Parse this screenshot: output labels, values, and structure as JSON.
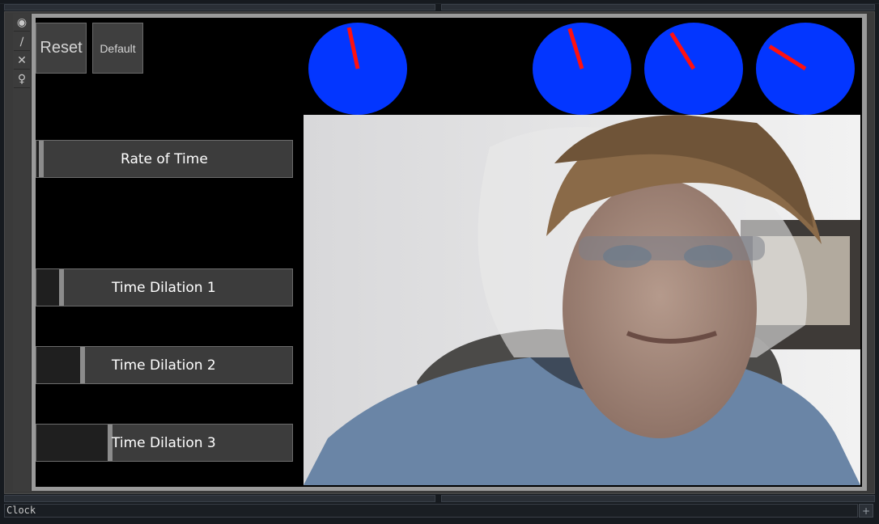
{
  "buttons": {
    "reset": "Reset",
    "default": "Default"
  },
  "toolbar": {
    "icons": [
      "viewer-icon",
      "path-icon",
      "close-icon",
      "lock-icon"
    ],
    "glyphs": [
      "◉",
      "∕",
      "✕",
      "♀"
    ]
  },
  "sliders": [
    {
      "label": "Rate of Time",
      "value": 0.01
    },
    {
      "label": "Time Dilation 1",
      "value": 0.09
    },
    {
      "label": "Time Dilation 2",
      "value": 0.17
    },
    {
      "label": "Time Dilation 3",
      "value": 0.28
    }
  ],
  "dials": [
    {
      "hand_angle_deg": -12
    },
    {
      "hand_angle_deg": -17
    },
    {
      "hand_angle_deg": -32
    },
    {
      "hand_angle_deg": -58
    }
  ],
  "colors": {
    "dial_face": "#0336ff",
    "dial_hand": "#ff1010"
  },
  "camera": {
    "content": "webcam-feed"
  },
  "status": {
    "text": "Clock"
  },
  "corner": {
    "glyph": "+"
  }
}
